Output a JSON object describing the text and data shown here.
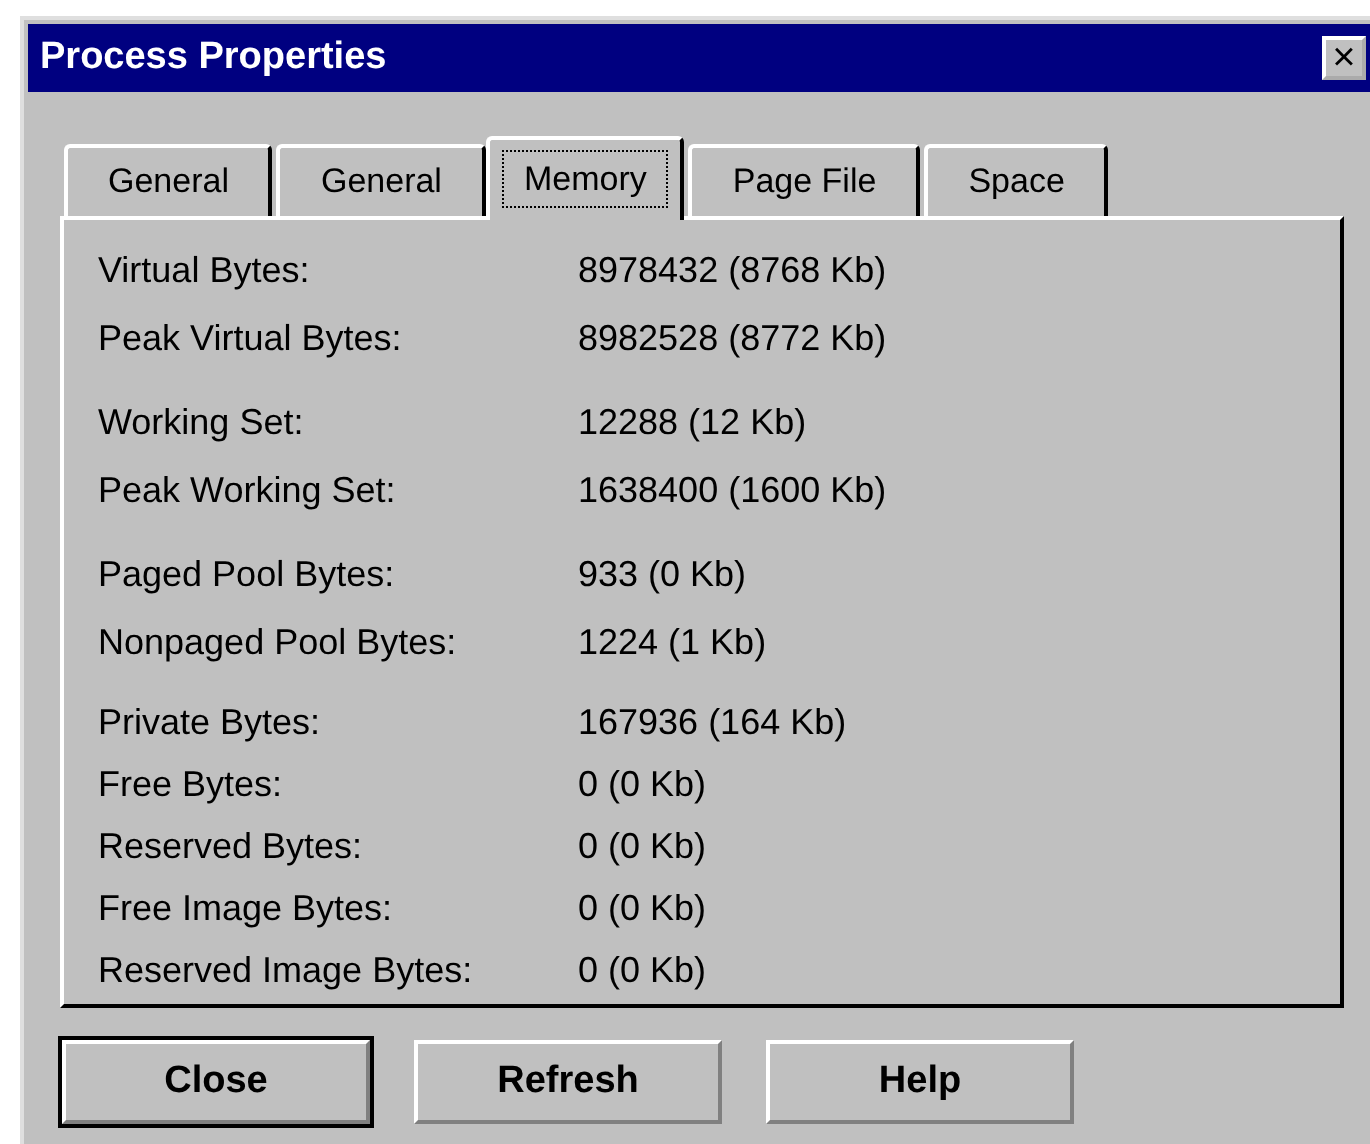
{
  "window": {
    "title": "Process Properties",
    "close": "×"
  },
  "tabs": [
    {
      "label": "General",
      "selected": false
    },
    {
      "label": "General",
      "selected": false
    },
    {
      "label": "Memory",
      "selected": true
    },
    {
      "label": "Page File",
      "selected": false
    },
    {
      "label": "Space",
      "selected": false
    }
  ],
  "groups": [
    [
      {
        "label": "Virtual Bytes:",
        "value": "8978432 (8768 Kb)"
      },
      {
        "label": "Peak Virtual Bytes:",
        "value": "8982528 (8772 Kb)"
      }
    ],
    [
      {
        "label": "Working Set:",
        "value": "12288 (12 Kb)"
      },
      {
        "label": "Peak Working Set:",
        "value": "1638400 (1600 Kb)"
      }
    ],
    [
      {
        "label": "Paged Pool Bytes:",
        "value": "933 (0 Kb)"
      },
      {
        "label": "Nonpaged Pool Bytes:",
        "value": "1224 (1 Kb)"
      }
    ],
    [
      {
        "label": "Private Bytes:",
        "value": "167936 (164 Kb)"
      },
      {
        "label": "Free Bytes:",
        "value": "0 (0 Kb)"
      },
      {
        "label": "Reserved Bytes:",
        "value": "0 (0 Kb)"
      },
      {
        "label": "Free Image Bytes:",
        "value": "0 (0 Kb)"
      },
      {
        "label": "Reserved Image Bytes:",
        "value": "0 (0 Kb)"
      }
    ]
  ],
  "buttons": [
    {
      "label": "Close",
      "default": true
    },
    {
      "label": "Refresh",
      "default": false
    },
    {
      "label": "Help",
      "default": false
    }
  ]
}
